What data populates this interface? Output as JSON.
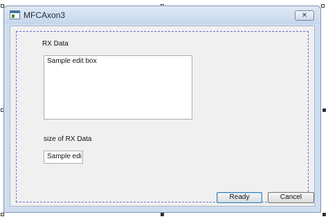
{
  "window": {
    "title": "MFCAxon3",
    "close_icon": "close-icon"
  },
  "dialog": {
    "rx_label": "RX Data",
    "rx_edit_value": "Sample edit box",
    "size_label": "size of RX Data",
    "size_edit_value": "Sample edi",
    "ready_button": "Ready",
    "cancel_button": "Cancel"
  },
  "icons": {
    "app": "app-window-icon",
    "close": "close-x-icon"
  },
  "colors": {
    "titlebar": "#cfdeef",
    "dialog_bg": "#f0f0f0",
    "guide": "#6b6bd6",
    "default_button_border": "#3c7fb1"
  }
}
